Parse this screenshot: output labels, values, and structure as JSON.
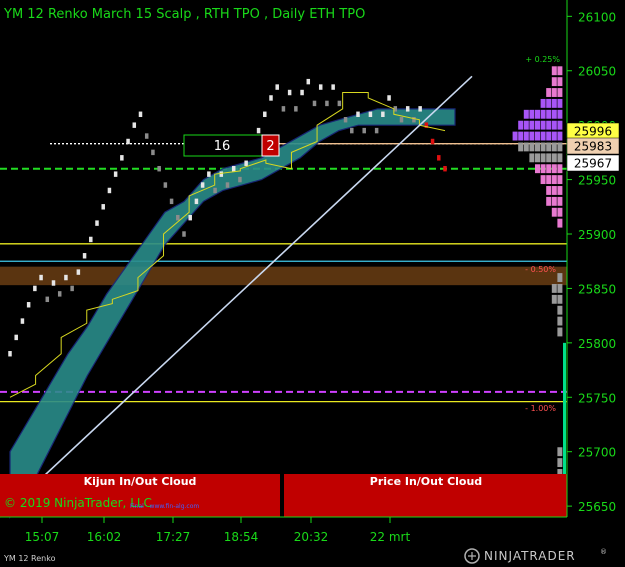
{
  "window": {
    "title": "YM 12 Renko March 15 Scalp , RTH TPO , Daily ETH TPO",
    "copyright": "© 2019 NinjaTrader, LLC",
    "watermark": "Final · www.fin-alg.com",
    "instrument_tab": "YM 12 Renko",
    "brand": "NINJATRADER",
    "brand_mark": "®"
  },
  "colors": {
    "background": "#000000",
    "text_green": "#19d919",
    "up_brick": "#e6e6e6",
    "down_brick": "#8c8c8c",
    "red_brick": "#e01010",
    "cloud": "#2a8c8a",
    "cloud_dark": "#1a2a80",
    "kijun": "#d8d820",
    "trendline": "#c9d8f0",
    "profile_violet": "#a855f7",
    "profile_pink": "#e879d0",
    "profile_gray": "#9a9a9a",
    "panel_red": "#c00000",
    "brown_zone": "#5a3410"
  },
  "chart_data": {
    "type": "renko",
    "brick_size": 5,
    "ylim": [
      25640,
      26115
    ],
    "y_ticks": [
      25650,
      25700,
      25750,
      25800,
      25850,
      25900,
      25950,
      26000,
      26050,
      26100
    ],
    "x_ticks": [
      "15:07",
      "16:02",
      "17:27",
      "18:54",
      "20:32",
      "22 mrt"
    ],
    "bricks": [
      {
        "c": 25790,
        "d": 1
      },
      {
        "c": 25805,
        "d": 1
      },
      {
        "c": 25820,
        "d": 1
      },
      {
        "c": 25835,
        "d": 1
      },
      {
        "c": 25850,
        "d": 1
      },
      {
        "c": 25860,
        "d": 1
      },
      {
        "c": 25840,
        "d": -1
      },
      {
        "c": 25855,
        "d": 1
      },
      {
        "c": 25845,
        "d": -1
      },
      {
        "c": 25860,
        "d": 1
      },
      {
        "c": 25850,
        "d": -1
      },
      {
        "c": 25865,
        "d": 1
      },
      {
        "c": 25880,
        "d": 1
      },
      {
        "c": 25895,
        "d": 1
      },
      {
        "c": 25910,
        "d": 1
      },
      {
        "c": 25925,
        "d": 1
      },
      {
        "c": 25940,
        "d": 1
      },
      {
        "c": 25955,
        "d": 1
      },
      {
        "c": 25970,
        "d": 1
      },
      {
        "c": 25985,
        "d": 1
      },
      {
        "c": 26000,
        "d": 1
      },
      {
        "c": 26010,
        "d": 1
      },
      {
        "c": 25990,
        "d": -1
      },
      {
        "c": 25975,
        "d": -1
      },
      {
        "c": 25960,
        "d": -1
      },
      {
        "c": 25945,
        "d": -1
      },
      {
        "c": 25930,
        "d": -1
      },
      {
        "c": 25915,
        "d": -1
      },
      {
        "c": 25900,
        "d": -1
      },
      {
        "c": 25915,
        "d": 1
      },
      {
        "c": 25930,
        "d": 1
      },
      {
        "c": 25945,
        "d": 1
      },
      {
        "c": 25955,
        "d": 1
      },
      {
        "c": 25940,
        "d": -1
      },
      {
        "c": 25955,
        "d": 1
      },
      {
        "c": 25945,
        "d": -1
      },
      {
        "c": 25960,
        "d": 1
      },
      {
        "c": 25950,
        "d": -1
      },
      {
        "c": 25965,
        "d": 1
      },
      {
        "c": 25980,
        "d": 1
      },
      {
        "c": 25995,
        "d": 1
      },
      {
        "c": 26010,
        "d": 1
      },
      {
        "c": 26025,
        "d": 1
      },
      {
        "c": 26035,
        "d": 1
      },
      {
        "c": 26015,
        "d": -1
      },
      {
        "c": 26030,
        "d": 1
      },
      {
        "c": 26015,
        "d": -1
      },
      {
        "c": 26030,
        "d": 1
      },
      {
        "c": 26040,
        "d": 1
      },
      {
        "c": 26020,
        "d": -1
      },
      {
        "c": 26035,
        "d": 1
      },
      {
        "c": 26020,
        "d": -1
      },
      {
        "c": 26035,
        "d": 1
      },
      {
        "c": 26020,
        "d": -1
      },
      {
        "c": 26005,
        "d": -1
      },
      {
        "c": 25995,
        "d": -1
      },
      {
        "c": 26010,
        "d": 1
      },
      {
        "c": 25995,
        "d": -1
      },
      {
        "c": 26010,
        "d": 1
      },
      {
        "c": 25995,
        "d": -1
      },
      {
        "c": 26010,
        "d": 1
      },
      {
        "c": 26025,
        "d": 1
      },
      {
        "c": 26015,
        "d": -1
      },
      {
        "c": 26005,
        "d": -1
      },
      {
        "c": 26015,
        "d": 1
      },
      {
        "c": 26005,
        "d": -1
      },
      {
        "c": 26015,
        "d": 1
      },
      {
        "c": 26000,
        "d": -2
      },
      {
        "c": 25985,
        "d": -2
      },
      {
        "c": 25970,
        "d": -2
      },
      {
        "c": 25960,
        "d": -2
      }
    ],
    "kijun": [
      [
        25750,
        25762
      ],
      [
        25770,
        25790
      ],
      [
        25805,
        25818
      ],
      [
        25830,
        25836
      ],
      [
        25840,
        25848
      ],
      [
        25860,
        25880
      ],
      [
        25900,
        25920
      ],
      [
        25935,
        25945
      ],
      [
        25955,
        25958
      ],
      [
        25960,
        25968
      ],
      [
        25965,
        25960
      ],
      [
        25975,
        25985
      ],
      [
        26000,
        26015
      ],
      [
        26030,
        26030
      ],
      [
        26025,
        26015
      ],
      [
        26010,
        26005
      ],
      [
        26000,
        25995
      ]
    ],
    "cloud_upper": [
      25700,
      25730,
      25760,
      25790,
      25815,
      25845,
      25870,
      25895,
      25920,
      25930,
      25950,
      25960,
      25965,
      25970,
      25980,
      25990,
      26000,
      26005,
      26010,
      26015,
      26015,
      26015,
      26015,
      26015
    ],
    "cloud_lower": [
      25640,
      25665,
      25700,
      25735,
      25770,
      25800,
      25830,
      25860,
      25890,
      25910,
      25930,
      25940,
      25945,
      25950,
      25960,
      25970,
      25985,
      25995,
      26000,
      26000,
      26000,
      26000,
      26000,
      26000
    ],
    "trendline": [
      [
        25640,
        26100
      ]
    ],
    "horizontal_lines": [
      {
        "name": "green-dashed",
        "value": 25960,
        "style": "dashed",
        "color": "#22dd22"
      },
      {
        "name": "white-dotted",
        "value": 25983,
        "style": "dotted",
        "color": "#ffffff"
      },
      {
        "name": "yellow-upper",
        "value": 25891,
        "style": "solid",
        "color": "#e8e820"
      },
      {
        "name": "cyan",
        "value": 25875,
        "style": "solid",
        "color": "#40c8e8"
      },
      {
        "name": "magenta-dashed",
        "value": 25755,
        "style": "dashed",
        "color": "#d040ff"
      },
      {
        "name": "yellow-lower",
        "value": 25746,
        "style": "solid",
        "color": "#e8e820"
      },
      {
        "name": "orange-dotted",
        "value": 25983,
        "style": "solid",
        "color": "#f0c090"
      }
    ],
    "brown_zone": [
      25853,
      25870
    ],
    "profile": {
      "levels": [
        {
          "p": 26050,
          "w": 2,
          "k": "pink"
        },
        {
          "p": 26040,
          "w": 2,
          "k": "pink"
        },
        {
          "p": 26030,
          "w": 3,
          "k": "pink"
        },
        {
          "p": 26020,
          "w": 4,
          "k": "violet"
        },
        {
          "p": 26010,
          "w": 7,
          "k": "violet"
        },
        {
          "p": 26000,
          "w": 8,
          "k": "violet"
        },
        {
          "p": 25990,
          "w": 9,
          "k": "violet"
        },
        {
          "p": 25980,
          "w": 8,
          "k": "gray"
        },
        {
          "p": 25970,
          "w": 6,
          "k": "gray"
        },
        {
          "p": 25960,
          "w": 5,
          "k": "pink"
        },
        {
          "p": 25950,
          "w": 4,
          "k": "pink"
        },
        {
          "p": 25940,
          "w": 3,
          "k": "pink"
        },
        {
          "p": 25930,
          "w": 3,
          "k": "pink"
        },
        {
          "p": 25920,
          "w": 2,
          "k": "pink"
        },
        {
          "p": 25910,
          "w": 1,
          "k": "pink"
        },
        {
          "p": 25860,
          "w": 1,
          "k": "gray"
        },
        {
          "p": 25850,
          "w": 2,
          "k": "gray"
        },
        {
          "p": 25840,
          "w": 2,
          "k": "gray"
        },
        {
          "p": 25830,
          "w": 1,
          "k": "gray"
        },
        {
          "p": 25820,
          "w": 1,
          "k": "gray"
        },
        {
          "p": 25810,
          "w": 1,
          "k": "gray"
        },
        {
          "p": 25700,
          "w": 1,
          "k": "gray"
        },
        {
          "p": 25690,
          "w": 1,
          "k": "gray"
        },
        {
          "p": 25680,
          "w": 1,
          "k": "gray"
        },
        {
          "p": 25670,
          "w": 1,
          "k": "gray"
        }
      ],
      "volume_bar": [
        25660,
        25800
      ]
    },
    "price_markers": [
      {
        "text": "25996",
        "value": 25996,
        "bg": "#ffff44",
        "fg": "#000000"
      },
      {
        "text": "25983",
        "value": 25983,
        "bg": "#f0d0b0",
        "fg": "#000000"
      },
      {
        "text": "25967",
        "value": 25967,
        "bg": "#ffffff",
        "fg": "#000000"
      }
    ],
    "annotations": {
      "pct_top": "+ 0.25%",
      "pct_mid": "- 0.50%",
      "pct_low": "- 1.00%"
    },
    "counters": {
      "box_value": "16",
      "badge_value": "2"
    },
    "panels": {
      "left_label": "Kijun In/Out Cloud",
      "right_label": "Price In/Out Cloud"
    }
  }
}
